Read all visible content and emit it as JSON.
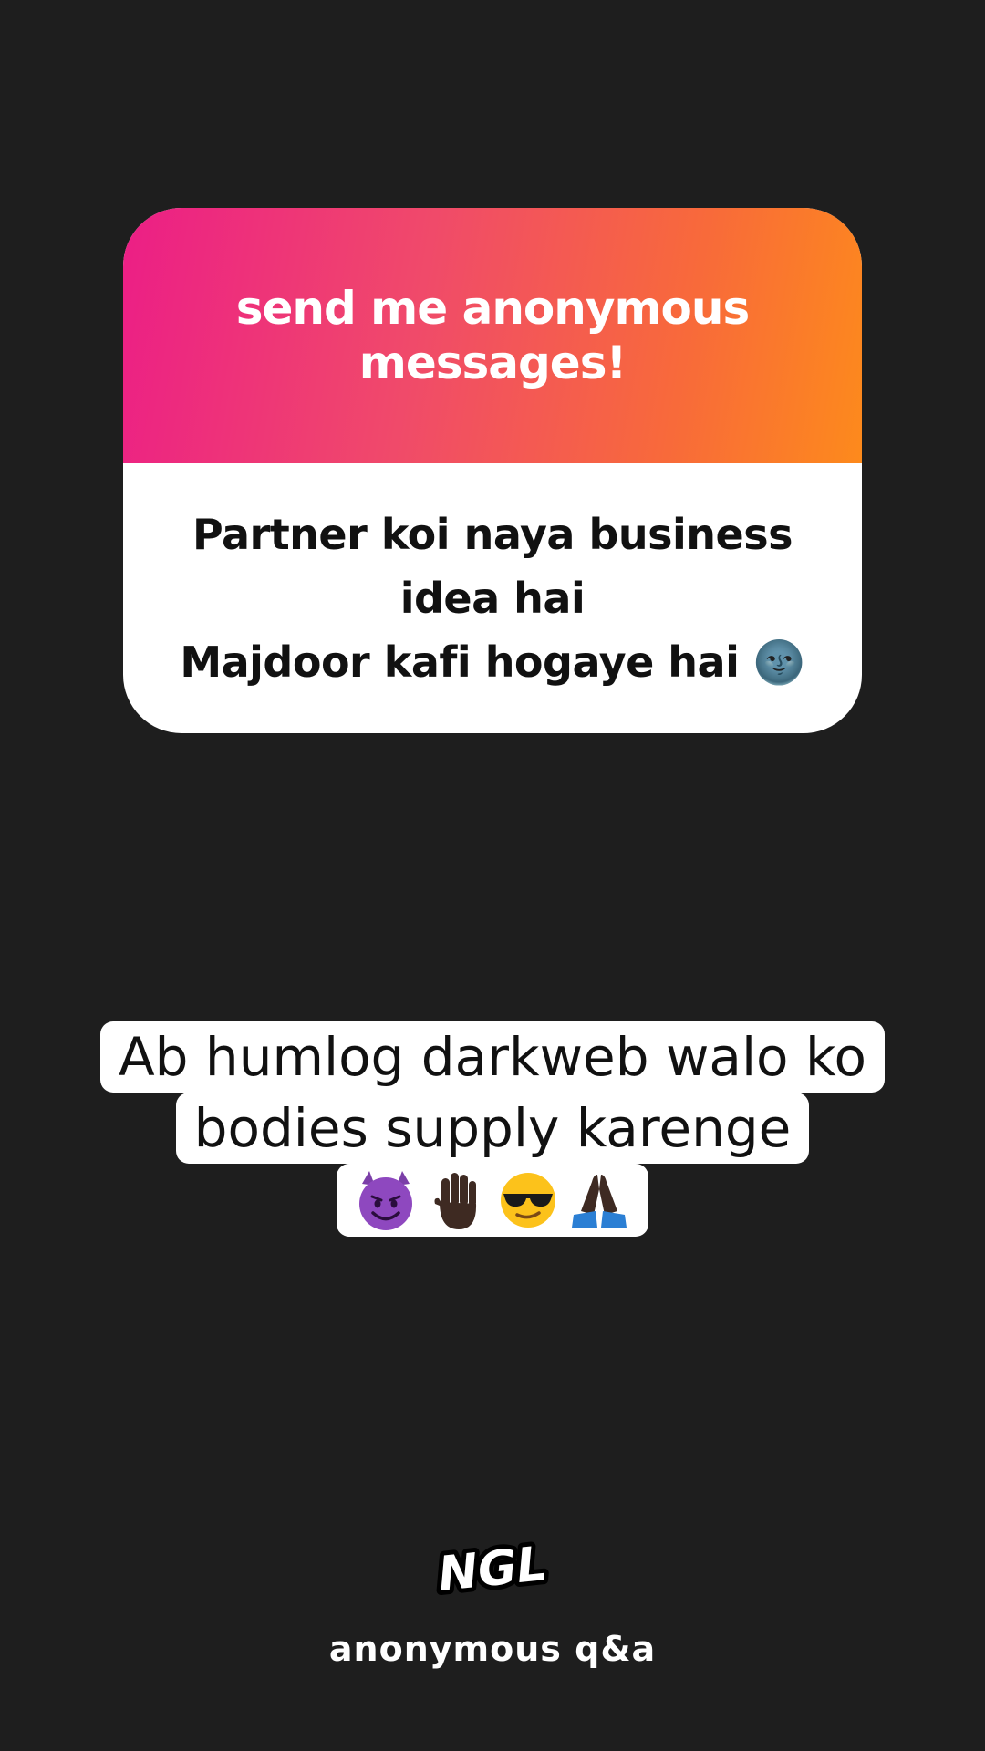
{
  "card": {
    "title": "send me anonymous messages!",
    "question": "Partner koi naya business\nidea hai\nMajdoor kafi hogaye hai 🌚"
  },
  "answer": {
    "line1": "Ab humlog darkweb walo ko",
    "line2": "bodies supply karenge",
    "emojis": [
      "smiling-devil-icon",
      "raised-hand-icon",
      "sunglasses-face-icon",
      "folded-hands-icon"
    ]
  },
  "footer": {
    "logo": "NGL",
    "label": "anonymous q&a"
  },
  "colors": {
    "background": "#1e1e1e",
    "gradient_start": "#ec1e86",
    "gradient_end": "#fd8a1c",
    "card_body": "#ffffff"
  }
}
